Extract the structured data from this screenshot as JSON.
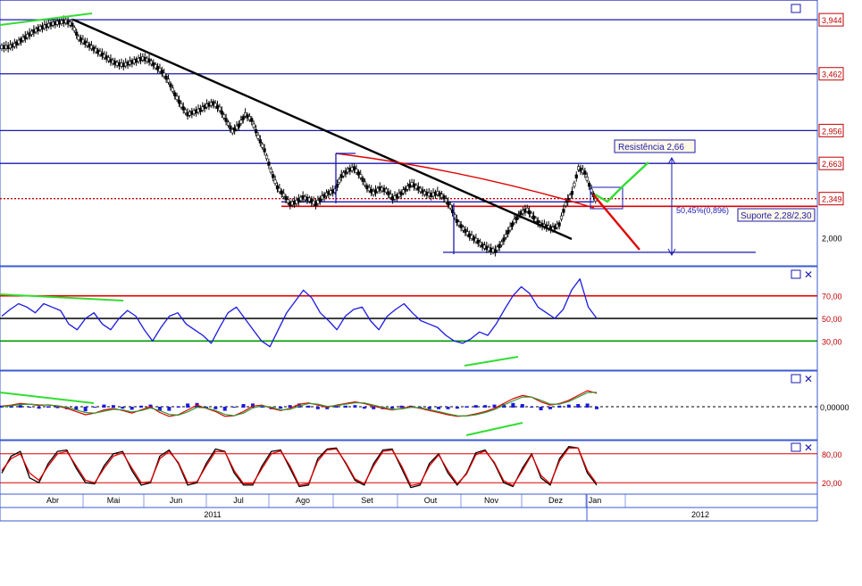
{
  "chart_data": [
    {
      "type": "candlestick",
      "panel": "price",
      "price_axis_labels": [
        "3,944",
        "3,462",
        "2,956",
        "2,663",
        "2,349",
        "2,000"
      ],
      "price_axis_ticks": [
        3.944,
        3.462,
        2.956,
        2.663,
        2.349,
        2.0
      ],
      "horizontal_levels": [
        4.12,
        3.944,
        3.462,
        2.956,
        2.663
      ],
      "dotted_level": 2.349,
      "support_level": 2.28,
      "ylim": [
        1.75,
        4.12
      ],
      "close_series": [
        3.7,
        3.72,
        3.76,
        3.8,
        3.84,
        3.87,
        3.89,
        3.91,
        3.92,
        3.93,
        3.9,
        3.78,
        3.74,
        3.7,
        3.66,
        3.62,
        3.58,
        3.55,
        3.54,
        3.56,
        3.58,
        3.6,
        3.58,
        3.53,
        3.48,
        3.4,
        3.28,
        3.18,
        3.1,
        3.12,
        3.14,
        3.18,
        3.2,
        3.15,
        3.05,
        2.95,
        3.0,
        3.1,
        3.05,
        2.9,
        2.78,
        2.6,
        2.45,
        2.38,
        2.3,
        2.32,
        2.36,
        2.34,
        2.3,
        2.36,
        2.4,
        2.42,
        2.55,
        2.6,
        2.62,
        2.55,
        2.45,
        2.4,
        2.44,
        2.42,
        2.35,
        2.38,
        2.43,
        2.48,
        2.44,
        2.4,
        2.38,
        2.4,
        2.36,
        2.28,
        2.15,
        2.08,
        2.02,
        1.98,
        1.93,
        1.9,
        1.88,
        1.95,
        2.05,
        2.15,
        2.22,
        2.25,
        2.18,
        2.12,
        2.1,
        2.08,
        2.12,
        2.3,
        2.4,
        2.62,
        2.58,
        2.42,
        2.3
      ],
      "annotations": {
        "resistance_label": "Resistência 2,66",
        "support_label": "Suporte 2,28/2,30",
        "retracement_label": "50,45%(0,896)"
      }
    },
    {
      "type": "line",
      "panel": "rsi",
      "axis_labels": [
        "70,00",
        "50,00",
        "30,00"
      ],
      "levels": [
        70,
        50,
        30
      ],
      "ylim": [
        5,
        95
      ],
      "series": [
        {
          "values": [
            52,
            58,
            63,
            60,
            55,
            63,
            60,
            57,
            45,
            40,
            50,
            55,
            45,
            40,
            50,
            57,
            52,
            40,
            30,
            42,
            52,
            55,
            45,
            40,
            35,
            28,
            42,
            55,
            60,
            50,
            40,
            30,
            25,
            40,
            55,
            65,
            75,
            68,
            55,
            48,
            40,
            52,
            58,
            60,
            48,
            40,
            52,
            58,
            63,
            55,
            48,
            45,
            42,
            35,
            30,
            28,
            32,
            38,
            35,
            45,
            58,
            70,
            78,
            72,
            60,
            55,
            50,
            58,
            75,
            85,
            60,
            50
          ]
        }
      ]
    },
    {
      "type": "line",
      "panel": "macd",
      "axis_labels": [
        "0,00000"
      ],
      "ylim": [
        -1,
        1
      ],
      "series": [
        {
          "values": [
            0.02,
            0.05,
            0.1,
            0.08,
            0.04,
            0.06,
            0.02,
            -0.05,
            -0.15,
            -0.25,
            -0.2,
            -0.1,
            -0.05,
            -0.12,
            -0.2,
            -0.1,
            0.0,
            -0.18,
            -0.3,
            -0.25,
            -0.1,
            0.05,
            -0.05,
            -0.15,
            -0.3,
            -0.28,
            -0.15,
            0.02,
            0.05,
            -0.05,
            -0.12,
            -0.05,
            0.08,
            0.12,
            0.05,
            -0.02,
            0.05,
            0.1,
            0.15,
            0.1,
            0.02,
            -0.05,
            -0.1,
            -0.05,
            0.0,
            -0.05,
            -0.12,
            -0.18,
            -0.25,
            -0.3,
            -0.28,
            -0.22,
            -0.15,
            -0.05,
            0.1,
            0.25,
            0.35,
            0.3,
            0.15,
            0.05,
            0.1,
            0.2,
            0.35,
            0.5,
            0.42
          ]
        },
        {
          "values": [
            0.0,
            0.03,
            0.07,
            0.08,
            0.06,
            0.05,
            0.03,
            -0.02,
            -0.1,
            -0.18,
            -0.2,
            -0.14,
            -0.08,
            -0.1,
            -0.16,
            -0.12,
            -0.04,
            -0.12,
            -0.24,
            -0.26,
            -0.16,
            -0.02,
            -0.04,
            -0.12,
            -0.24,
            -0.28,
            -0.2,
            -0.04,
            0.03,
            -0.02,
            -0.1,
            -0.08,
            0.02,
            0.1,
            0.08,
            0.01,
            0.03,
            0.08,
            0.12,
            0.12,
            0.05,
            -0.02,
            -0.08,
            -0.07,
            -0.02,
            -0.03,
            -0.09,
            -0.15,
            -0.22,
            -0.28,
            -0.29,
            -0.25,
            -0.18,
            -0.09,
            0.05,
            0.18,
            0.3,
            0.3,
            0.2,
            0.08,
            0.08,
            0.16,
            0.3,
            0.44,
            0.45
          ]
        }
      ]
    },
    {
      "type": "line",
      "panel": "stochastic",
      "axis_labels": [
        "80,00",
        "20,00"
      ],
      "levels": [
        80,
        20
      ],
      "ylim": [
        0,
        100
      ],
      "series": [
        {
          "values": [
            40,
            75,
            85,
            30,
            20,
            60,
            85,
            88,
            50,
            20,
            18,
            55,
            80,
            85,
            45,
            15,
            20,
            75,
            88,
            60,
            15,
            20,
            60,
            90,
            85,
            40,
            15,
            15,
            55,
            85,
            88,
            50,
            12,
            15,
            70,
            90,
            92,
            60,
            25,
            15,
            60,
            88,
            90,
            50,
            10,
            15,
            60,
            80,
            40,
            15,
            40,
            82,
            88,
            60,
            20,
            12,
            50,
            80,
            30,
            15,
            70,
            95,
            92,
            40,
            15
          ]
        },
        {
          "values": [
            45,
            70,
            80,
            40,
            25,
            55,
            80,
            85,
            55,
            25,
            20,
            50,
            75,
            82,
            50,
            20,
            22,
            70,
            85,
            62,
            20,
            22,
            55,
            85,
            84,
            45,
            18,
            18,
            50,
            80,
            86,
            55,
            15,
            18,
            65,
            88,
            90,
            62,
            28,
            18,
            55,
            85,
            88,
            55,
            14,
            18,
            55,
            78,
            45,
            18,
            38,
            78,
            86,
            62,
            24,
            14,
            45,
            78,
            35,
            18,
            65,
            92,
            92,
            45,
            18
          ]
        }
      ]
    },
    {
      "type": "axis",
      "panel": "time",
      "month_labels": [
        "Abr",
        "Mai",
        "Jun",
        "Jul",
        "Ago",
        "Set",
        "Out",
        "Nov",
        "Dez",
        "Jan"
      ],
      "year_labels": [
        "2011",
        "2012"
      ]
    }
  ]
}
